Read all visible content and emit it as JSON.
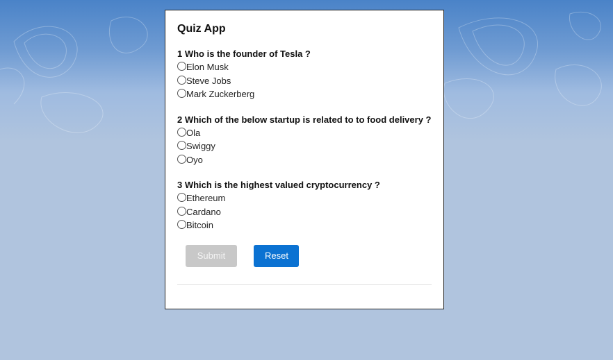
{
  "app": {
    "title": "Quiz App"
  },
  "questions": [
    {
      "text": "1 Who is the founder of Tesla ?",
      "options": [
        "Elon Musk",
        "Steve Jobs",
        "Mark Zuckerberg"
      ]
    },
    {
      "text": "2 Which of the below startup is related to to food delivery ?",
      "options": [
        "Ola",
        "Swiggy",
        "Oyo"
      ]
    },
    {
      "text": "3 Which is the highest valued cryptocurrency ?",
      "options": [
        "Ethereum",
        "Cardano",
        "Bitcoin"
      ]
    }
  ],
  "actions": {
    "submit_label": "Submit",
    "reset_label": "Reset"
  },
  "colors": {
    "page_bg": "#b0c4de",
    "reset_button": "#0b72d2",
    "submit_disabled": "#c8c8c8"
  }
}
